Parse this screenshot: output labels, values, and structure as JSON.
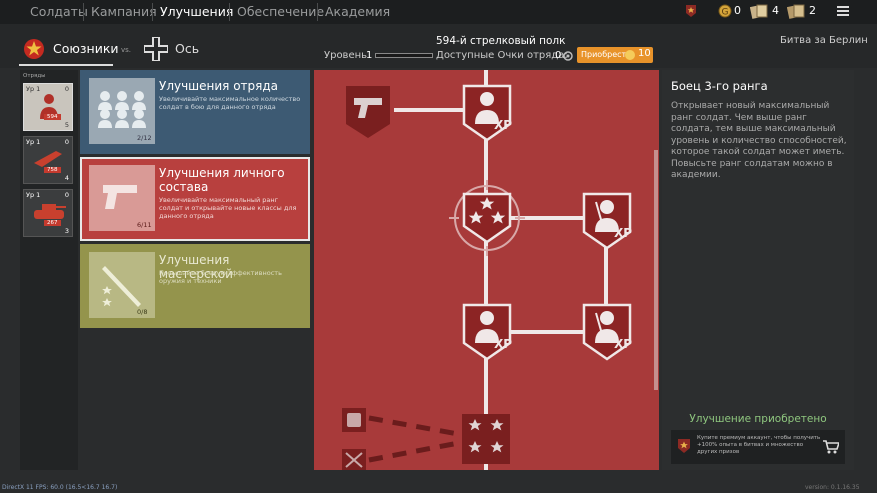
{
  "topnav": {
    "tabs": [
      "Солдаты",
      "Кампания",
      "Улучшения",
      "Обеспечение",
      "Академия"
    ],
    "active": "Улучшения"
  },
  "resources": {
    "gold": "0",
    "cards": "4",
    "orders": "2"
  },
  "sides": {
    "allies": "Союзники",
    "vs": "vs.",
    "axis": "Ось"
  },
  "campaign": "Битва за Берлин",
  "regiment": {
    "name": "594-й стрелковый полк",
    "level_label": "Уровень",
    "level": "1",
    "points_label": "Доступные Очки отряда:",
    "points": "0",
    "buy_label": "Приобрести",
    "buy_price": "10"
  },
  "squads_header": "Отряды",
  "squads": [
    {
      "level": "Ур 1",
      "points": "0",
      "badge": "594",
      "count": "5"
    },
    {
      "level": "Ур 1",
      "points": "0",
      "badge": "758",
      "count": "4"
    },
    {
      "level": "Ур 1",
      "points": "0",
      "badge": "267",
      "count": "3"
    }
  ],
  "cards": [
    {
      "title": "Улучшения отряда",
      "desc": "Увеличивайте максимальное количество солдат в бою для данного отряда",
      "count": "2/12"
    },
    {
      "title": "Улучшения личного состава",
      "desc": "Увеличивайте максимальный ранг солдат и открывайте новые классы для данного отряда",
      "count": "6/11"
    },
    {
      "title": "Улучшения мастерской",
      "desc": "Повышайте боевую эффективность оружия и техники",
      "count": "0/8"
    }
  ],
  "details": {
    "title": "Боец 3-го ранга",
    "desc": "Открывает новый максимальный ранг солдат. Чем выше ранг солдата, тем выше максимальный уровень и количество способностей, которое такой солдат может иметь. Повысьте ранг солдатам можно в академии.",
    "status": "Улучшение приобретено"
  },
  "premium": {
    "text": "Купите премиум аккаунт, чтобы получить +100% опыта в битвах и множество других призов"
  },
  "footer": {
    "fps": "DirectX 11 FPS: 60.0 (16.5<16.7 16.7)",
    "version": "version: 0.1.16.35"
  },
  "tree_label": "XP",
  "colors": {
    "tree_bg": "#a83a3a",
    "node_bg": "#8c2424",
    "accent": "#e8932a",
    "card1": "#3d5a73",
    "card2": "#b8403e",
    "card3": "#94944c",
    "status_ok": "#8fc77f"
  }
}
